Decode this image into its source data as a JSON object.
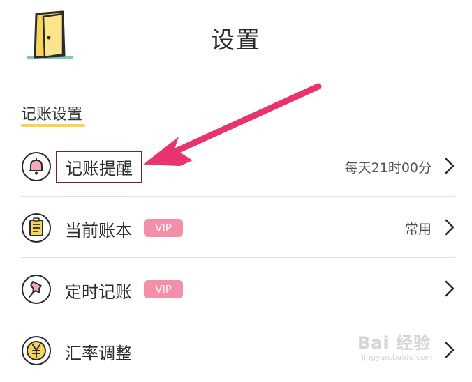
{
  "header": {
    "title": "设置",
    "door_icon": "door-icon"
  },
  "section": {
    "title": "记账设置"
  },
  "rows": [
    {
      "label": "记账提醒",
      "value": "每天21时00分",
      "icon": "bell-icon",
      "vip": ""
    },
    {
      "label": "当前账本",
      "value": "常用",
      "icon": "notebook-icon",
      "vip": "VIP"
    },
    {
      "label": "定时记账",
      "value": "",
      "icon": "pushpin-icon",
      "vip": "VIP"
    },
    {
      "label": "汇率调整",
      "value": "",
      "icon": "yen-icon",
      "vip": ""
    }
  ],
  "colors": {
    "accent_yellow": "#f7d34f",
    "vip_pink": "#f38fa9",
    "annotation_arrow": "#e8336d",
    "annotation_box": "#7d1f24"
  },
  "watermark": {
    "text": "Bai 经验",
    "url": "jingyan.baidu.com"
  }
}
